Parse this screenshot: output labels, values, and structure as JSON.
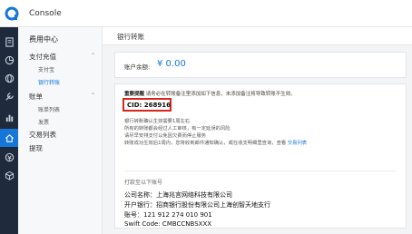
{
  "app": {
    "title": "Console",
    "brand_color": "#1677d8"
  },
  "rail": {
    "icons": [
      "doc-icon",
      "chart-icon",
      "globe-icon",
      "tools-icon",
      "bar-chart-icon",
      "home-icon",
      "money-icon",
      "box-icon"
    ]
  },
  "sidebar": {
    "title": "费用中心",
    "groups": [
      {
        "label": "支付充值",
        "expanded": true,
        "items": [
          {
            "label": "支付宝"
          },
          {
            "label": "银行转账",
            "active": true
          }
        ]
      },
      {
        "label": "账单",
        "expanded": true,
        "items": [
          {
            "label": "账单列表"
          },
          {
            "label": "发票"
          }
        ]
      },
      {
        "label": "交易列表"
      },
      {
        "label": "提现"
      }
    ]
  },
  "main": {
    "breadcrumb": "银行转账",
    "balance": {
      "label": "账户余额:",
      "value": "¥ 0.00"
    },
    "notice": {
      "title": "重要提醒",
      "text": "请务必在转账备注里添加如下信息，未添加备注将导致转账不生效。"
    },
    "cid": "CID: 268916",
    "tips": [
      "银行转账确认生效需要1周左右",
      "所有的转账都会经过人工审核，有一定延误的风险",
      "请尽早安排支付以免因欠费而停止服务",
      "转账成功生效后1周内，您将收到邮件通知确认，或在收支明细里查询，查看"
    ],
    "tips_link": "交易列表",
    "bank": {
      "intro": "打款至以下账号",
      "company": "公司名称：上海兆言网络科技有限公司",
      "bank_name": "开户银行：招商银行股份有限公司上海创智天地支行",
      "account": "账号：121 912 274 010 901",
      "swift": "Swift Code: CMBCCNBSXXX"
    }
  }
}
